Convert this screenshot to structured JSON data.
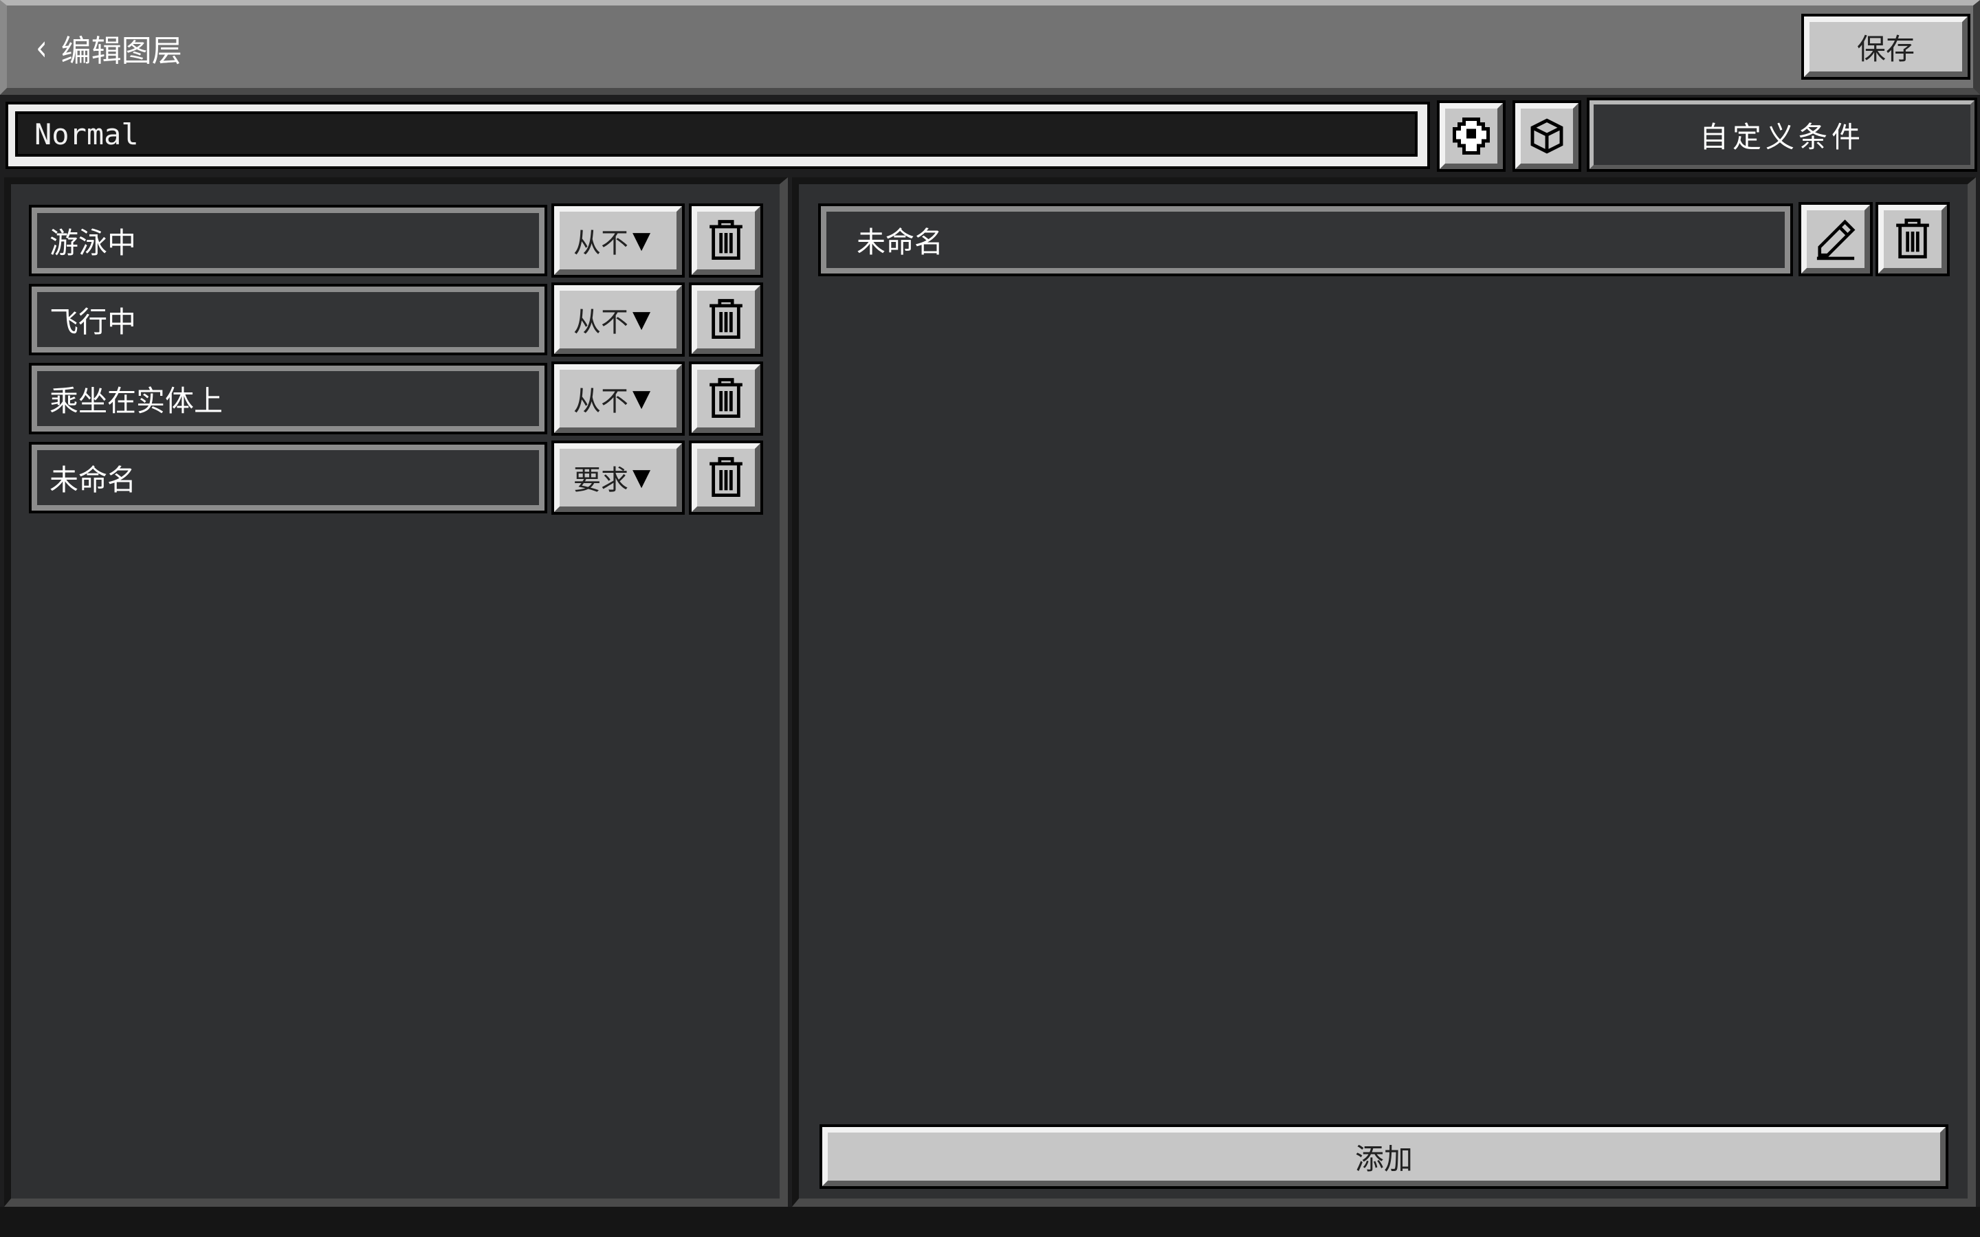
{
  "header": {
    "back_label": "编辑图层",
    "save_label": "保存"
  },
  "layer": {
    "name": "Normal",
    "custom_conditions_label": "自定义条件"
  },
  "conditions": [
    {
      "name": "游泳中",
      "mode": "从不"
    },
    {
      "name": "飞行中",
      "mode": "从不"
    },
    {
      "name": "乘坐在实体上",
      "mode": "从不"
    },
    {
      "name": "未命名",
      "mode": "要求"
    }
  ],
  "custom_conditions": [
    {
      "name": "未命名"
    }
  ],
  "add_label": "添加",
  "icons": {
    "back": "chevron-left-icon",
    "skin": "skin-icon",
    "cube": "cube-icon",
    "dropdown": "triangle-down-icon",
    "delete": "trash-icon",
    "edit": "pencil-icon"
  }
}
